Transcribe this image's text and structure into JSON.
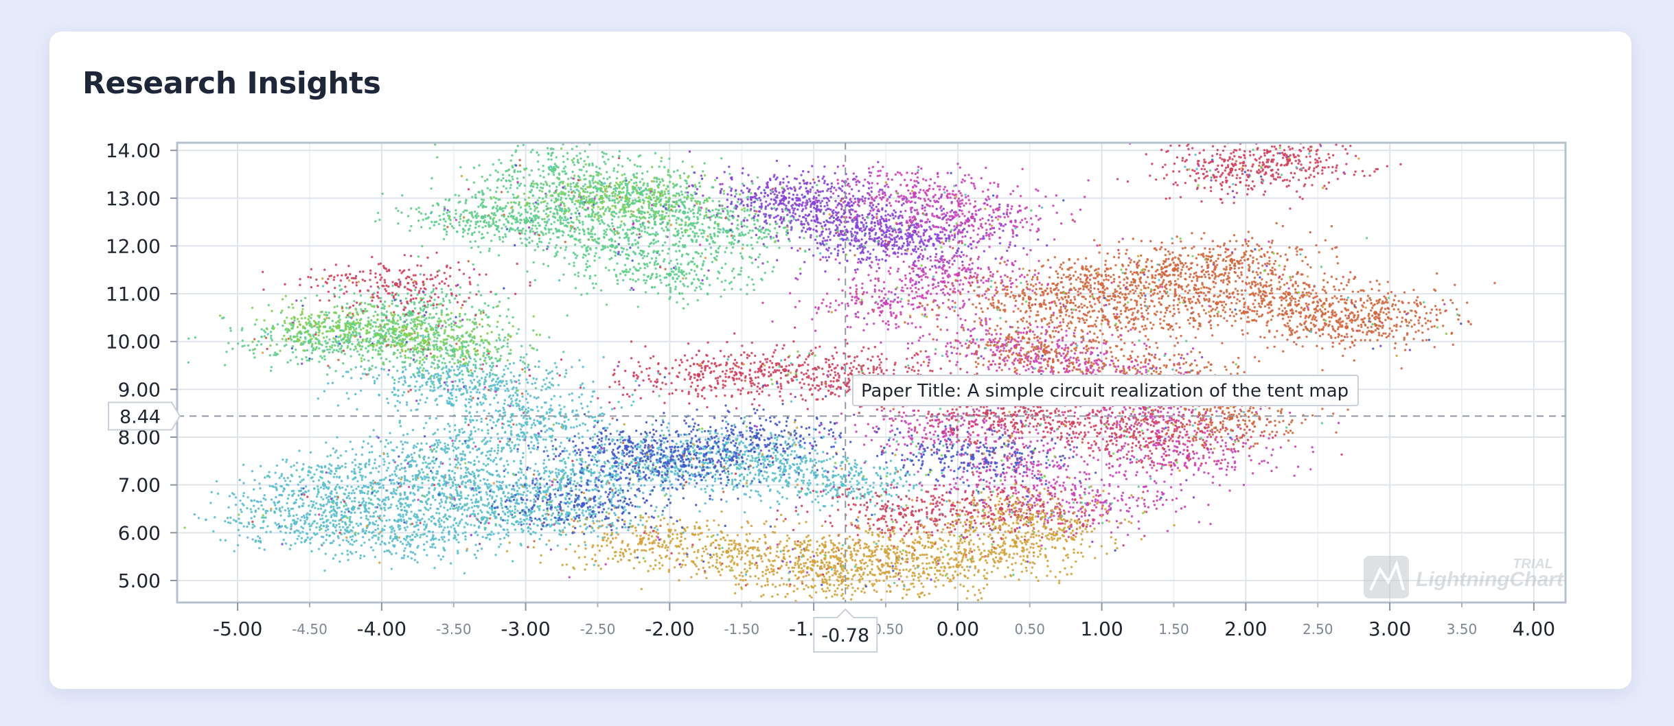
{
  "page": {
    "title": "Research Insights"
  },
  "chart_data": {
    "type": "scatter",
    "title": "",
    "xlabel": "",
    "ylabel": "",
    "xlim": [
      -5.42,
      4.22
    ],
    "ylim": [
      4.54,
      14.16
    ],
    "grid": true,
    "x_ticks_major": [
      "-5.00",
      "-4.00",
      "-3.00",
      "-2.00",
      "-1.00",
      "0.00",
      "1.00",
      "2.00",
      "3.00",
      "4.00"
    ],
    "x_ticks_minor": [
      "-4.50",
      "-3.50",
      "-2.50",
      "-1.50",
      "-0.50",
      "0.50",
      "1.50",
      "2.50",
      "3.50"
    ],
    "y_ticks": [
      "5.00",
      "6.00",
      "7.00",
      "8.00",
      "9.00",
      "10.00",
      "11.00",
      "12.00",
      "13.00",
      "14.00"
    ],
    "crosshair": {
      "x": -0.78,
      "y": 8.44,
      "x_label": "-0.78",
      "y_label": "8.44"
    },
    "tooltip": "Paper Title: A simple circuit realization of the tent map",
    "watermark": "LightningChart",
    "watermark_badge": "TRIAL",
    "colors": {
      "cyan": "#5bbfcd",
      "green": "#5fce8c",
      "purple": "#8844d6",
      "magenta": "#cc44b8",
      "crimson": "#d2425e",
      "orange": "#d2683f",
      "gold": "#d4a33c",
      "blue": "#4459cc",
      "lime": "#82d152"
    },
    "clusters": [
      {
        "name": "cyan",
        "color": "#5bbfcd",
        "points": [
          [
            -4.6,
            6.2
          ],
          [
            -4.2,
            6.5
          ],
          [
            -3.9,
            5.9
          ],
          [
            -3.6,
            6.8
          ],
          [
            -3.3,
            6.3
          ],
          [
            -3.0,
            7.0
          ],
          [
            -2.7,
            6.4
          ],
          [
            -2.4,
            7.2
          ],
          [
            -2.0,
            7.5
          ],
          [
            -1.6,
            7.7
          ],
          [
            -1.2,
            7.3
          ],
          [
            -0.8,
            7.0
          ],
          [
            -4.4,
            7.0
          ],
          [
            -3.8,
            7.4
          ],
          [
            -3.4,
            7.8
          ],
          [
            -2.9,
            8.3
          ],
          [
            -3.6,
            9.2
          ],
          [
            -3.2,
            9.0
          ]
        ]
      },
      {
        "name": "green",
        "color": "#5fce8c",
        "points": [
          [
            -4.5,
            10.0
          ],
          [
            -4.0,
            10.1
          ],
          [
            -3.5,
            9.8
          ],
          [
            -3.0,
            12.5
          ],
          [
            -2.6,
            12.9
          ],
          [
            -2.2,
            13.1
          ],
          [
            -1.9,
            12.7
          ],
          [
            -2.4,
            12.0
          ],
          [
            -2.0,
            11.4
          ],
          [
            -2.8,
            13.6
          ],
          [
            -3.3,
            12.6
          ],
          [
            -3.8,
            10.6
          ],
          [
            -1.6,
            12.3
          ]
        ]
      },
      {
        "name": "purple",
        "color": "#8844d6",
        "points": [
          [
            -1.0,
            12.9
          ],
          [
            -0.5,
            12.0
          ],
          [
            -0.3,
            12.3
          ],
          [
            -1.2,
            13.0
          ],
          [
            -0.7,
            12.4
          ]
        ]
      },
      {
        "name": "magenta",
        "color": "#cc44b8",
        "points": [
          [
            -0.5,
            10.8
          ],
          [
            0.0,
            11.4
          ],
          [
            0.4,
            9.9
          ],
          [
            0.9,
            9.4
          ],
          [
            1.3,
            8.6
          ],
          [
            1.6,
            7.6
          ],
          [
            0.9,
            6.6
          ],
          [
            0.4,
            7.3
          ],
          [
            -0.1,
            8.1
          ],
          [
            -0.3,
            13.1
          ],
          [
            0.1,
            12.6
          ]
        ]
      },
      {
        "name": "crimson",
        "color": "#d2425e",
        "points": [
          [
            -1.8,
            9.3
          ],
          [
            -1.2,
            9.4
          ],
          [
            -0.6,
            9.2
          ],
          [
            0.2,
            8.5
          ],
          [
            0.8,
            8.3
          ],
          [
            1.4,
            8.0
          ],
          [
            -3.9,
            11.2
          ],
          [
            2.3,
            13.8
          ],
          [
            1.9,
            13.6
          ],
          [
            -0.4,
            6.4
          ],
          [
            0.3,
            6.5
          ]
        ]
      },
      {
        "name": "orange",
        "color": "#d2683f",
        "points": [
          [
            0.5,
            10.9
          ],
          [
            1.0,
            11.2
          ],
          [
            1.5,
            11.5
          ],
          [
            1.9,
            11.7
          ],
          [
            2.3,
            11.0
          ],
          [
            2.7,
            10.3
          ],
          [
            1.1,
            10.5
          ],
          [
            0.6,
            9.8
          ],
          [
            1.8,
            10.8
          ],
          [
            1.4,
            9.3
          ],
          [
            2.9,
            10.6
          ],
          [
            1.9,
            8.4
          ]
        ]
      },
      {
        "name": "gold",
        "color": "#d4a33c",
        "points": [
          [
            -1.6,
            5.6
          ],
          [
            -1.0,
            5.4
          ],
          [
            -0.5,
            5.6
          ],
          [
            0.0,
            5.3
          ],
          [
            0.4,
            5.8
          ],
          [
            -2.2,
            5.8
          ],
          [
            0.5,
            6.3
          ],
          [
            -0.8,
            5.0
          ]
        ]
      },
      {
        "name": "blue",
        "color": "#4459cc",
        "points": [
          [
            -2.3,
            7.8
          ],
          [
            -1.9,
            7.4
          ],
          [
            -1.4,
            8.0
          ],
          [
            -2.6,
            6.6
          ],
          [
            0.1,
            7.6
          ]
        ]
      },
      {
        "name": "lime",
        "color": "#82d152",
        "points": [
          [
            -4.3,
            10.3
          ],
          [
            -3.7,
            10.0
          ],
          [
            -2.3,
            13.0
          ]
        ]
      }
    ]
  }
}
